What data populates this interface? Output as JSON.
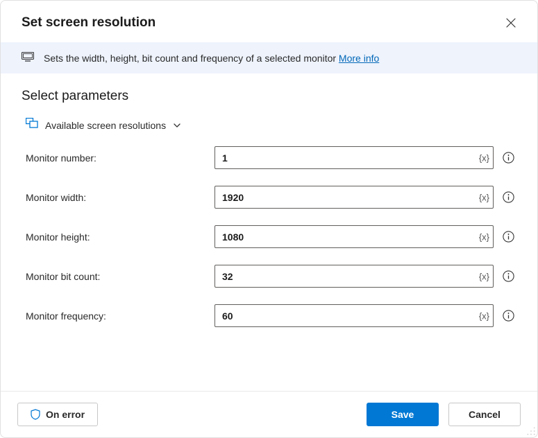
{
  "header": {
    "title": "Set screen resolution"
  },
  "banner": {
    "text": "Sets the width, height, bit count and frequency of a selected monitor ",
    "link": "More info"
  },
  "section": {
    "title": "Select parameters",
    "collapsible_label": "Available screen resolutions"
  },
  "fields": {
    "monitor_number": {
      "label": "Monitor number:",
      "value": "1"
    },
    "monitor_width": {
      "label": "Monitor width:",
      "value": "1920"
    },
    "monitor_height": {
      "label": "Monitor height:",
      "value": "1080"
    },
    "monitor_bit_count": {
      "label": "Monitor bit count:",
      "value": "32"
    },
    "monitor_frequency": {
      "label": "Monitor frequency:",
      "value": "60"
    }
  },
  "footer": {
    "on_error": "On error",
    "save": "Save",
    "cancel": "Cancel"
  },
  "expr_token": "{x}"
}
